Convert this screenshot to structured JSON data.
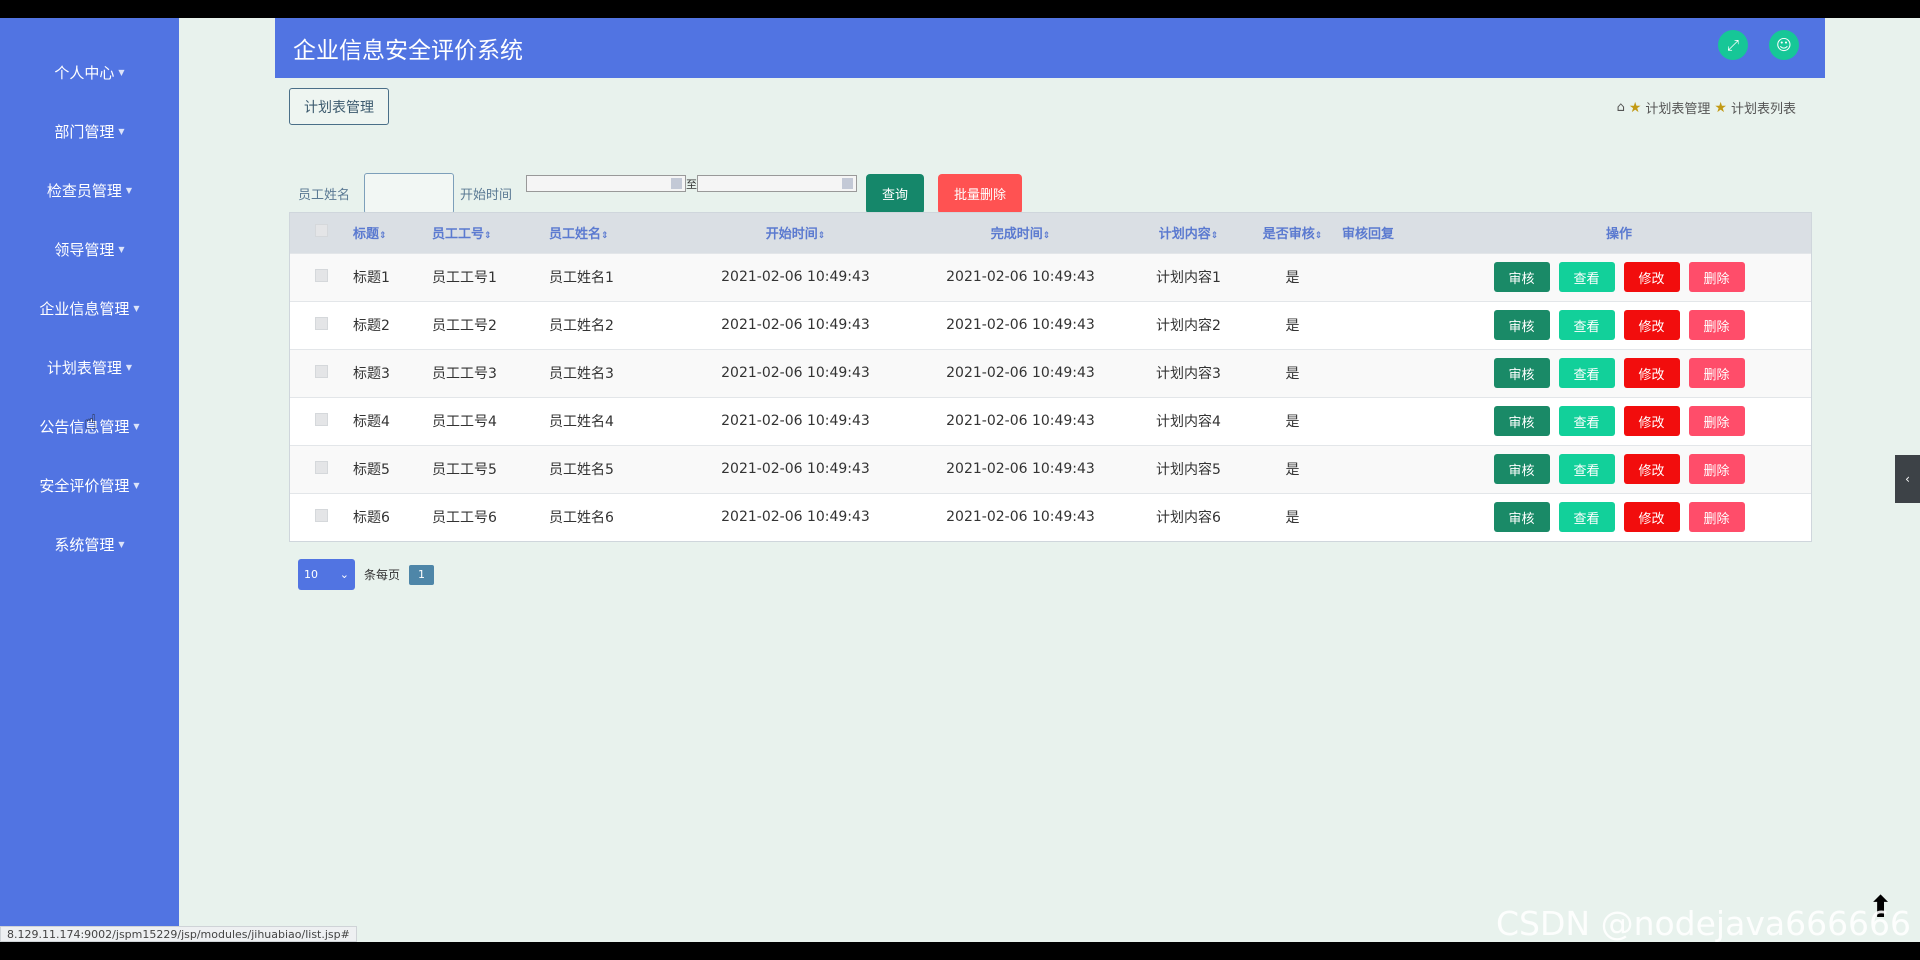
{
  "sidebar": {
    "items": [
      {
        "label": "个人中心"
      },
      {
        "label": "部门管理"
      },
      {
        "label": "检查员管理"
      },
      {
        "label": "领导管理"
      },
      {
        "label": "企业信息管理"
      },
      {
        "label": "计划表管理"
      },
      {
        "label": "公告信息管理"
      },
      {
        "label": "安全评价管理"
      },
      {
        "label": "系统管理"
      }
    ]
  },
  "header": {
    "title": "企业信息安全评价系统"
  },
  "page": {
    "tag": "计划表管理",
    "breadcrumb": [
      "计划表管理",
      "计划表列表"
    ]
  },
  "search": {
    "name_label": "员工姓名",
    "start_label": "开始时间",
    "to_label": "至",
    "query_button": "查询",
    "batch_delete_button": "批量删除"
  },
  "table": {
    "headers": [
      "标题",
      "员工工号",
      "员工姓名",
      "开始时间",
      "完成时间",
      "计划内容",
      "是否审核",
      "审核回复",
      "操作"
    ],
    "rows": [
      {
        "title": "标题1",
        "emp_no": "员工工号1",
        "emp_name": "员工姓名1",
        "start": "2021-02-06 10:49:43",
        "end": "2021-02-06 10:49:43",
        "content": "计划内容1",
        "audited": "是"
      },
      {
        "title": "标题2",
        "emp_no": "员工工号2",
        "emp_name": "员工姓名2",
        "start": "2021-02-06 10:49:43",
        "end": "2021-02-06 10:49:43",
        "content": "计划内容2",
        "audited": "是"
      },
      {
        "title": "标题3",
        "emp_no": "员工工号3",
        "emp_name": "员工姓名3",
        "start": "2021-02-06 10:49:43",
        "end": "2021-02-06 10:49:43",
        "content": "计划内容3",
        "audited": "是"
      },
      {
        "title": "标题4",
        "emp_no": "员工工号4",
        "emp_name": "员工姓名4",
        "start": "2021-02-06 10:49:43",
        "end": "2021-02-06 10:49:43",
        "content": "计划内容4",
        "audited": "是"
      },
      {
        "title": "标题5",
        "emp_no": "员工工号5",
        "emp_name": "员工姓名5",
        "start": "2021-02-06 10:49:43",
        "end": "2021-02-06 10:49:43",
        "content": "计划内容5",
        "audited": "是"
      },
      {
        "title": "标题6",
        "emp_no": "员工工号6",
        "emp_name": "员工姓名6",
        "start": "2021-02-06 10:49:43",
        "end": "2021-02-06 10:49:43",
        "content": "计划内容6",
        "audited": "是"
      }
    ],
    "actions": {
      "audit": "审核",
      "view": "查看",
      "edit": "修改",
      "delete": "删除"
    }
  },
  "pager": {
    "page_size": "10",
    "per_page_label": "条每页",
    "current_page": "1"
  },
  "statusbar": {
    "url": "8.129.11.174:9002/jspm15229/jsp/modules/jihuabiao/list.jsp#"
  },
  "watermark": "CSDN @nodejava666666",
  "colors": {
    "primary": "#5174e2",
    "audit": "#1a8a67",
    "view": "#12d09a",
    "edit": "#f20d0d",
    "delete": "#ff4d6a",
    "batch_delete": "#ff5252"
  }
}
